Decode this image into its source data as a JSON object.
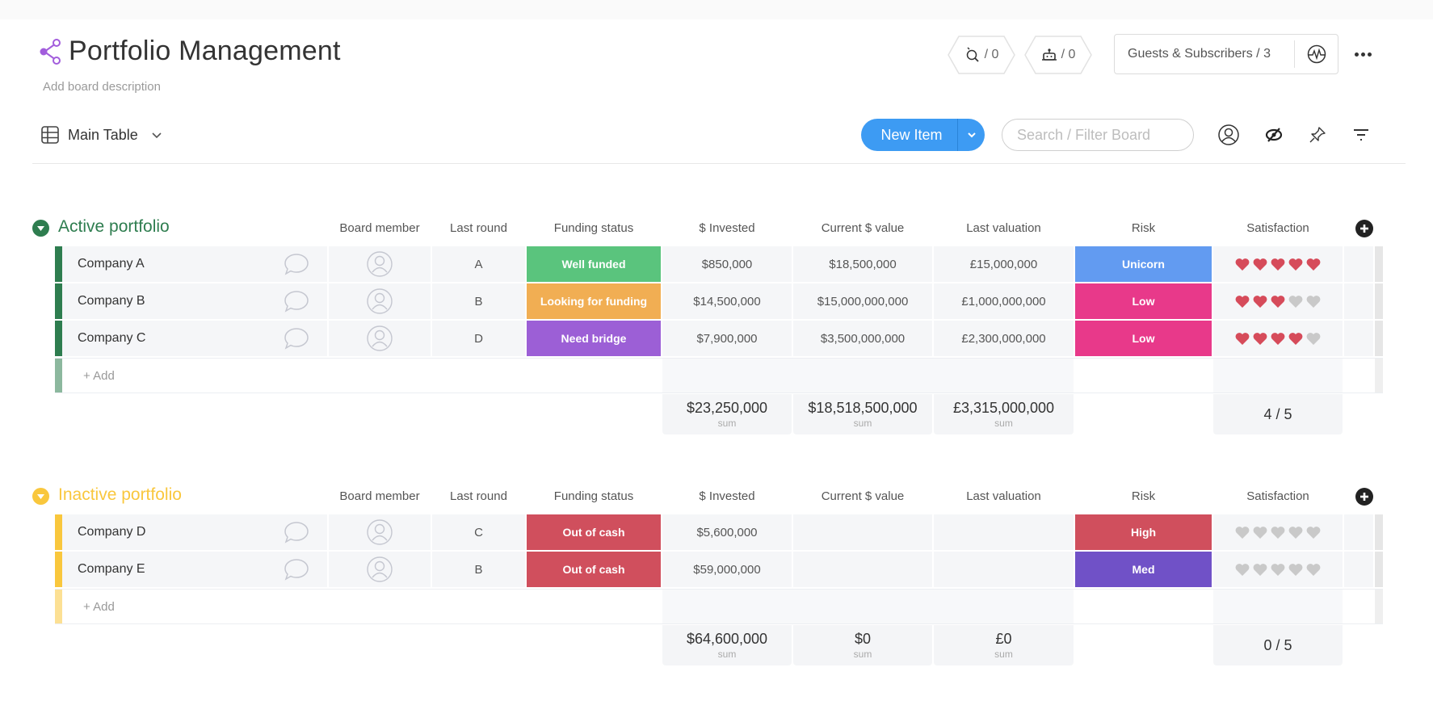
{
  "board": {
    "title": "Portfolio Management",
    "description_placeholder": "Add board description",
    "integrations_count": "/ 0",
    "automations_count": "/ 0",
    "guests_label": "Guests & Subscribers / 3"
  },
  "toolbar": {
    "view_label": "Main Table",
    "new_item_label": "New Item",
    "search_placeholder": "Search / Filter Board"
  },
  "columns": [
    "Board member",
    "Last round",
    "Funding status",
    "$ Invested",
    "Current $ value",
    "Last valuation",
    "Risk",
    "Satisfaction"
  ],
  "colors": {
    "accent": "#3d9bf3",
    "active_group": "#2e7d4f",
    "inactive_group": "#f9c73d",
    "well_funded": "#5ac47d",
    "looking_for_funding": "#f1ae53",
    "need_bridge": "#9c5fd6",
    "out_of_cash": "#d04f5d",
    "unicorn": "#629bf1",
    "low": "#e8398a",
    "high": "#d04f5d",
    "med": "#7051c7",
    "heart_on": "#d64b5a",
    "heart_off": "#c9c9c9"
  },
  "groups": [
    {
      "title": "Active portfolio",
      "color": "#2e7d4f",
      "add_label": "+ Add",
      "rows": [
        {
          "name": "Company A",
          "last_round": "A",
          "funding_status": "Well funded",
          "funding_color": "#5ac47d",
          "invested": "$850,000",
          "current_value": "$18,500,000",
          "last_valuation": "£15,000,000",
          "risk": "Unicorn",
          "risk_color": "#629bf1",
          "satisfaction": 5
        },
        {
          "name": "Company B",
          "last_round": "B",
          "funding_status": "Looking for funding",
          "funding_color": "#f1ae53",
          "invested": "$14,500,000",
          "current_value": "$15,000,000,000",
          "last_valuation": "£1,000,000,000",
          "risk": "Low",
          "risk_color": "#e8398a",
          "satisfaction": 3
        },
        {
          "name": "Company C",
          "last_round": "D",
          "funding_status": "Need bridge",
          "funding_color": "#9c5fd6",
          "invested": "$7,900,000",
          "current_value": "$3,500,000,000",
          "last_valuation": "£2,300,000,000",
          "risk": "Low",
          "risk_color": "#e8398a",
          "satisfaction": 4
        }
      ],
      "summary": {
        "invested": "$23,250,000",
        "current_value": "$18,518,500,000",
        "last_valuation": "£3,315,000,000",
        "sum_label": "sum",
        "satisfaction": "4 / 5"
      }
    },
    {
      "title": "Inactive portfolio",
      "color": "#f9c73d",
      "add_label": "+ Add",
      "rows": [
        {
          "name": "Company D",
          "last_round": "C",
          "funding_status": "Out of cash",
          "funding_color": "#d04f5d",
          "invested": "$5,600,000",
          "current_value": "",
          "last_valuation": "",
          "risk": "High",
          "risk_color": "#d04f5d",
          "satisfaction": 0
        },
        {
          "name": "Company E",
          "last_round": "B",
          "funding_status": "Out of cash",
          "funding_color": "#d04f5d",
          "invested": "$59,000,000",
          "current_value": "",
          "last_valuation": "",
          "risk": "Med",
          "risk_color": "#7051c7",
          "satisfaction": 0
        }
      ],
      "summary": {
        "invested": "$64,600,000",
        "current_value": "$0",
        "last_valuation": "£0",
        "sum_label": "sum",
        "satisfaction": "0 / 5"
      }
    }
  ]
}
